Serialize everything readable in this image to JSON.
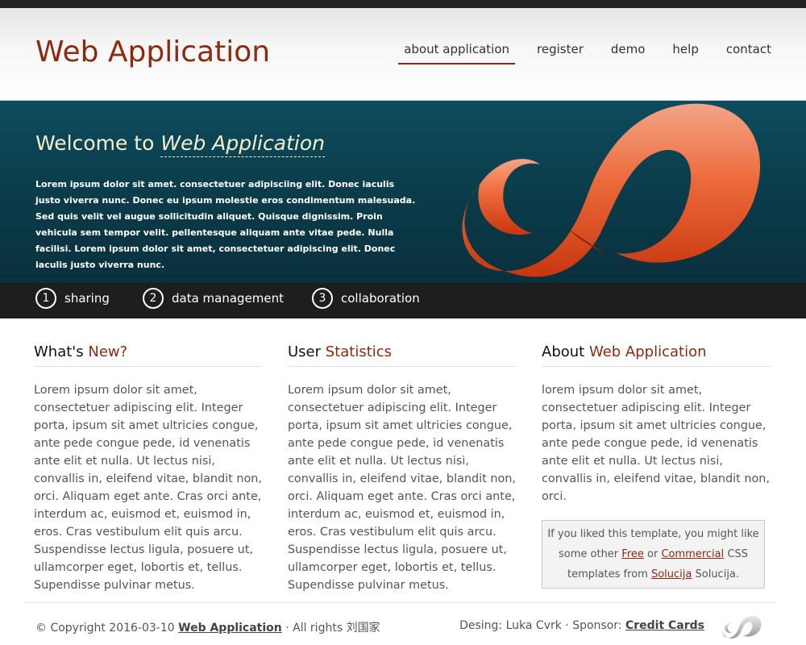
{
  "header": {
    "logo": "Web Application",
    "nav": [
      {
        "label": "about application",
        "active": true
      },
      {
        "label": "register"
      },
      {
        "label": "demo"
      },
      {
        "label": "help"
      },
      {
        "label": "contact"
      }
    ]
  },
  "hero": {
    "title_prefix": "Welcome to",
    "title_highlight": "Web Application",
    "text": "Lorem ipsum dolor sit amet. consectetuer adipisciing elit. Donec iaculis justo viverra nunc. Donec eu ipsum molestie eros condimentum malesuada. Sed quis velit vel augue sollicitudin aliquet. Quisque dignissim. Proin vehicula sem tempor velit. pellentesque aliquam ante vitae pede. Nulla facilisi. Lorem ipsum dolor sit amet, consectetuer adipiscing elit. Donec iaculis justo viverra nunc.",
    "logo_icon": "infinity-logo-icon"
  },
  "features": [
    {
      "num": "1",
      "label": "sharing"
    },
    {
      "num": "2",
      "label": "data management"
    },
    {
      "num": "3",
      "label": "collaboration"
    }
  ],
  "columns": [
    {
      "title_plain": "What's",
      "title_highlight": "New?",
      "text": "Lorem ipsum dolor sit amet, consectetuer adipiscing elit. Integer porta, ipsum sit amet ultricies congue, ante pede congue pede, id venenatis ante elit et nulla. Ut lectus nisi, convallis in, eleifend vitae, blandit non, orci. Aliquam eget ante. Cras orci ante, interdum ac, euismod et, euismod in, eros. Cras vestibulum elit quis arcu. Suspendisse lectus ligula, posuere ut, ullamcorper eget, lobortis et, tellus. Supendisse pulvinar metus."
    },
    {
      "title_plain": "User",
      "title_highlight": "Statistics",
      "text": "Lorem ipsum dolor sit amet, consectetuer adipiscing elit. Integer porta, ipsum sit amet ultricies congue, ante pede congue pede, id venenatis ante elit et nulla. Ut lectus nisi, convallis in, eleifend vitae, blandit non, orci. Aliquam eget ante. Cras orci ante, interdum ac, euismod et, euismod in, eros. Cras vestibulum elit quis arcu. Suspendisse lectus ligula, posuere ut, ullamcorper eget, lobortis et, tellus. Supendisse pulvinar metus."
    },
    {
      "title_plain": "About",
      "title_highlight": "Web Application",
      "text": "lorem ipsum dolor sit amet, consectetuer adipiscing elit. Integer porta, ipsum sit amet ultricies congue, ante pede congue pede, id venenatis ante elit et nulla. Ut lectus nisi, convallis in, eleifend vitae, blandit non, orci."
    }
  ],
  "promo": {
    "text1": "If you liked this template, you might like some other",
    "link_free": "Free",
    "text2": "or",
    "link_commercial": "Commercial",
    "text3": "CSS templates from",
    "link_solucija": "Solucija",
    "text4": "Solucija."
  },
  "footer": {
    "copyright_prefix": "© Copyright 2016-03-10",
    "copyright_link": "Web Application",
    "copyright_suffix": "· All rights 刘国家",
    "credits_prefix": "Desing: Luka Cvrk · Sponsor:",
    "credits_link": "Credit Cards",
    "logo_icon": "infinity-logo-small-icon"
  },
  "colors": {
    "accent": "#8b2a0f",
    "hero_bg": "#0b3b49",
    "feature_bar": "#1e1e1e",
    "logo_orange": "#e8541f"
  }
}
